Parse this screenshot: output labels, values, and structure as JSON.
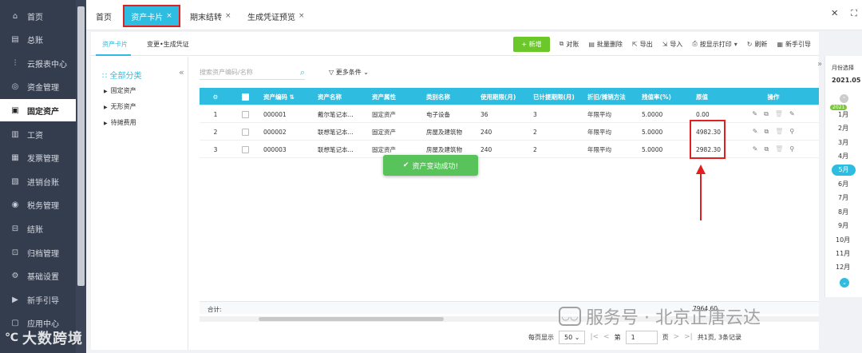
{
  "sidebar": {
    "items": [
      {
        "label": "首页",
        "icon": "home-icon"
      },
      {
        "label": "总账",
        "icon": "ledger-icon"
      },
      {
        "label": "云报表中心",
        "icon": "chart-icon"
      },
      {
        "label": "资金管理",
        "icon": "money-icon"
      },
      {
        "label": "固定资产",
        "icon": "asset-icon"
      },
      {
        "label": "工资",
        "icon": "salary-icon"
      },
      {
        "label": "发票管理",
        "icon": "invoice-icon"
      },
      {
        "label": "进销台账",
        "icon": "inventory-icon"
      },
      {
        "label": "税务管理",
        "icon": "tax-icon"
      },
      {
        "label": "结账",
        "icon": "close-book-icon"
      },
      {
        "label": "归档管理",
        "icon": "archive-icon"
      },
      {
        "label": "基础设置",
        "icon": "settings-icon"
      },
      {
        "label": "新手引导",
        "icon": "guide-icon"
      },
      {
        "label": "应用中心",
        "icon": "apps-icon"
      }
    ],
    "active_index": 4
  },
  "watermark_left": "大数跨境",
  "tabs": {
    "home": "首页",
    "asset_card": "资产卡片",
    "period_end": "期末结转",
    "voucher_preview": "生成凭证预览",
    "close": "×"
  },
  "subtabs": {
    "card": "资产卡片",
    "change": "变更•生成凭证"
  },
  "toolbar": {
    "add": "+ 新增",
    "reconcile": "对账",
    "batch_delete": "批量删除",
    "export": "导出",
    "import": "导入",
    "print": "按显示打印",
    "refresh": "刷新",
    "guide": "新手引导"
  },
  "tree": {
    "all": "全部分类",
    "nodes": [
      "固定资产",
      "无形资产",
      "待摊费用"
    ]
  },
  "search": {
    "placeholder": "搜索资产编码/名称",
    "more": "更多条件"
  },
  "table": {
    "headers": [
      "",
      "",
      "资产编码",
      "资产名称",
      "资产属性",
      "类别名称",
      "使用期限(月)",
      "已计提期限(月)",
      "折旧/摊销方法",
      "残值率(%)",
      "原值",
      "操作"
    ],
    "rows": [
      {
        "index": "1",
        "code": "000001",
        "name": "戴尔笔记本...",
        "attr": "固定资产",
        "category": "电子设备",
        "life": "36",
        "accrued": "3",
        "method": "年限平均",
        "residual": "5.0000",
        "value": "0.00"
      },
      {
        "index": "2",
        "code": "000002",
        "name": "联想笔记本...",
        "attr": "固定资产",
        "category": "房屋及建筑物",
        "life": "240",
        "accrued": "2",
        "method": "年限平均",
        "residual": "5.0000",
        "value": "4982.30"
      },
      {
        "index": "3",
        "code": "000003",
        "name": "联想笔记本...",
        "attr": "固定资产",
        "category": "房屋及建筑物",
        "life": "240",
        "accrued": "2",
        "method": "年限平均",
        "residual": "5.0000",
        "value": "2982.30"
      }
    ]
  },
  "totals": {
    "label": "合计:",
    "value": "7964.60"
  },
  "toast": "资产变动成功!",
  "pager": {
    "per_page_label": "每页显示",
    "per_page": "50",
    "page_prefix": "第",
    "page": "1",
    "page_suffix": "页",
    "summary": "共1页, 3条记录"
  },
  "month_panel": {
    "title": "月份选择",
    "current": "2021.05",
    "year_badge": "2021",
    "months": [
      "1月",
      "2月",
      "3月",
      "4月",
      "5月",
      "6月",
      "7月",
      "8月",
      "9月",
      "10月",
      "11月",
      "12月"
    ],
    "active_index": 4
  },
  "watermark_right": "服务号 · 北京正唐云达"
}
